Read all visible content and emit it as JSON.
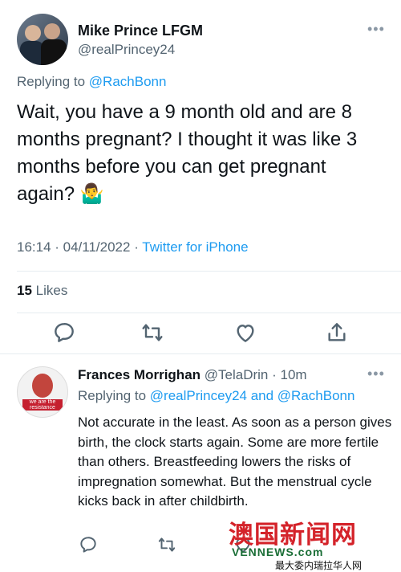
{
  "tweet": {
    "author_name": "Mike Prince LFGM",
    "author_handle": "@realPrincey24",
    "replying_prefix": "Replying to ",
    "replying_to": "@RachBonn",
    "text": "Wait, you have a 9 month old and are 8 months pregnant? I thought it was like 3 months before you can get pregnant again? 🤷‍♂️",
    "time": "16:14 · 04/11/2022 · ",
    "source": "Twitter for iPhone",
    "likes_count": "15",
    "likes_label": " Likes",
    "more_glyph": "•••"
  },
  "reply": {
    "author_name": "Frances Morrighan",
    "author_handle": " @TelaDrin · 10m",
    "avatar_text": "we are the resistance",
    "replying_prefix": "Replying to ",
    "replying_to_1": "@realPrincey24",
    "replying_and": " and ",
    "replying_to_2": "@RachBonn",
    "text": "Not accurate in the least. As soon as a person gives birth, the clock starts again. Some are more fertile than others. Breastfeeding lowers the risks of impregnation somewhat. But the menstrual cycle kicks back in after childbirth.",
    "more_glyph": "•••"
  },
  "watermark": {
    "big": "澳国新闻网",
    "site": "VENNEWS.com",
    "tagline": "最大委内瑞拉华人网"
  },
  "icons": [
    "reply-icon",
    "retweet-icon",
    "like-icon",
    "share-icon"
  ],
  "colors": {
    "link": "#1d9bf0",
    "muted": "#536471",
    "text": "#0f1419"
  }
}
